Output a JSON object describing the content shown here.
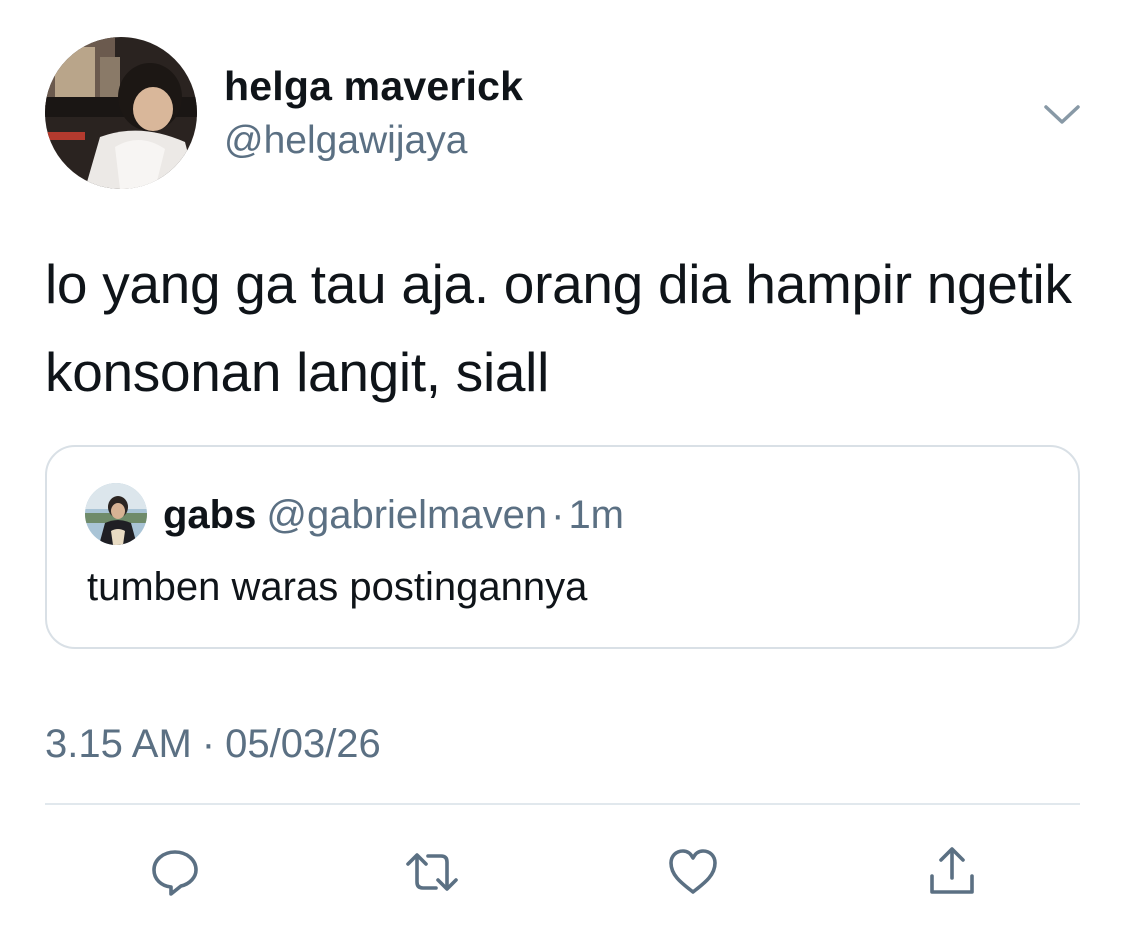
{
  "author": {
    "display_name": "helga maverick",
    "handle": "@helgawijaya",
    "avatar_icon": "profile-photo"
  },
  "tweet": {
    "text": "lo yang ga tau aja. orang dia hampir ngetik konsonan langit, siall"
  },
  "quoted_tweet": {
    "display_name": "gabs",
    "handle": "@gabrielmaven",
    "separator": "·",
    "time": "1m",
    "text": "tumben waras postingannya",
    "avatar_icon": "profile-photo"
  },
  "meta": {
    "time": "3.15 AM",
    "separator": "·",
    "date": "05/03/26"
  },
  "actions": [
    {
      "name": "reply",
      "icon": "reply-icon"
    },
    {
      "name": "retweet",
      "icon": "retweet-icon"
    },
    {
      "name": "like",
      "icon": "heart-icon"
    },
    {
      "name": "share",
      "icon": "share-icon"
    }
  ],
  "colors": {
    "text_primary": "#0f1419",
    "text_secondary": "#5b7083",
    "border": "#d9e0e6",
    "icon": "#5b7083"
  }
}
